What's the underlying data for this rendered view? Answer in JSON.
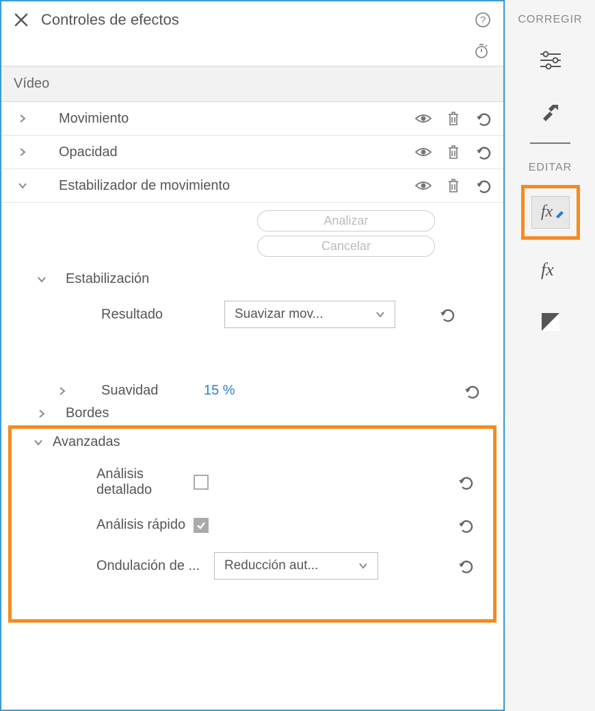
{
  "panel": {
    "title": "Controles de efectos",
    "section": "Vídeo",
    "effects": {
      "movement": "Movimiento",
      "opacity": "Opacidad",
      "stabilizer": "Estabilizador de movimiento"
    },
    "buttons": {
      "analyze": "Analizar",
      "cancel": "Cancelar"
    },
    "stabilization": {
      "heading": "Estabilización",
      "result_label": "Resultado",
      "result_value": "Suavizar mov...",
      "smoothness_label": "Suavidad",
      "smoothness_value": "15 %",
      "borders_label": "Bordes"
    },
    "advanced": {
      "heading": "Avanzadas",
      "detailed_label": "Análisis detallado",
      "fast_label": "Análisis rápido",
      "ripple_label": "Ondulación de ...",
      "ripple_value": "Reducción aut..."
    }
  },
  "sidebar": {
    "correct": "CORREGIR",
    "edit": "EDITAR"
  }
}
